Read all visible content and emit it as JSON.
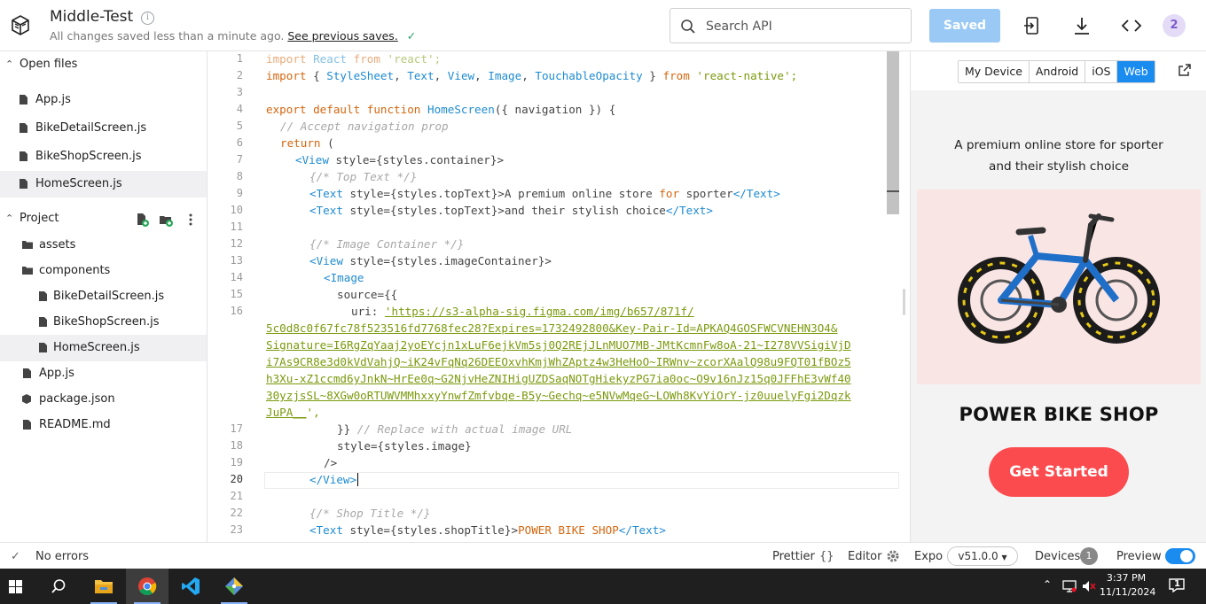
{
  "header": {
    "project_title": "Middle-Test",
    "save_status": "All changes saved less than a minute ago.",
    "previous_saves_link": "See previous saves.",
    "search_placeholder": "Search API",
    "saved_button": "Saved",
    "avatar_count": "2"
  },
  "sidebar": {
    "open_files_label": "Open files",
    "open_files": [
      "App.js",
      "BikeDetailScreen.js",
      "BikeShopScreen.js",
      "HomeScreen.js"
    ],
    "project_label": "Project",
    "tree": {
      "assets": "assets",
      "components": "components",
      "components_children": [
        "BikeDetailScreen.js",
        "BikeShopScreen.js",
        "HomeScreen.js"
      ],
      "app": "App.js",
      "package": "package.json",
      "readme": "README.md"
    }
  },
  "editor": {
    "line_numbers": [
      "1",
      "2",
      "3",
      "4",
      "5",
      "6",
      "7",
      "8",
      "9",
      "10",
      "11",
      "12",
      "13",
      "14",
      "15",
      "16",
      "17",
      "18",
      "19",
      "20",
      "21",
      "22",
      "23"
    ],
    "current_line": "20",
    "code": {
      "l1_import": "import",
      "l1_name": "React",
      "l1_from": "from",
      "l1_str": "'react';",
      "l2_import": "import",
      "l2_names_open": "{ ",
      "l2_names": [
        "StyleSheet",
        "Text",
        "View",
        "Image",
        "TouchableOpacity"
      ],
      "l2_names_close": " }",
      "l2_from": "from",
      "l2_str": "'react-native';",
      "l4_kw": "export default function",
      "l4_fn": "HomeScreen",
      "l4_rest": "({ navigation }) {",
      "l5": "// Accept navigation prop",
      "l6_kw": "return",
      "l6_rest": " (",
      "l7_tag": "<View",
      "l7_rest": " style={styles.container}>",
      "l8": "{/* Top Text */}",
      "l9_open": "<Text",
      "l9_attr": " style={styles.topText}>",
      "l9_text_a": "A premium online store ",
      "l9_for": "for",
      "l9_text_b": " sporter",
      "l9_close": "</Text>",
      "l10_open": "<Text",
      "l10_attr": " style={styles.topText}>",
      "l10_text": "and their stylish choice",
      "l10_close": "</Text>",
      "l12": "{/* Image Container */}",
      "l13_tag": "<View",
      "l13_rest": " style={styles.imageContainer}>",
      "l14_tag": "<Image",
      "l15": "source={{",
      "l16_key": "uri: ",
      "l16_url": "'https://s3-alpha-sig.figma.com/img/b657/871f/",
      "url_wrap": [
        "5c0d8c0f67fc78f523516fd7768fec28?Expires=1732492800&Key-Pair-Id=APKAQ4GOSFWCVNEHN3O4&",
        "Signature=I6RgZqYaaj2yoEYcjn1xLuF6ejkVm5sj0Q2REjJLnMUO7MB-JMtKcmnFw8oA-21~I278VVSigiVjD",
        "i7As9CR8e3d0kVdVahjQ~iK24vFqNq26DEEOxvhKmjWhZAptz4w3HeHoO~IRWnv~zcorXAalQ98u9FQT01fBOz5",
        "h3Xu-xZ1ccmd6yJnkN~HrEe0q~G2NjvHeZNIHigUZDSaqNOTgHiekyzPG7ia0oc~O9v16nJz15q0JFFhE3vWf40",
        "30yzjsSL~8XGw0oRTUWVMMhxxyYnwfZmfvbqe-B5y~Gechq~e5NVwMqeG~LOWh8KvYiOrY-jz0uuelyFgi2Dqzk",
        "JuPA__"
      ],
      "url_tail": "',",
      "l17_rest": "}}",
      "l17_comment": "// Replace with actual image URL",
      "l18": "style={styles.image}",
      "l19": "/>",
      "l20_open": "</",
      "l20_tag": "View",
      "l20_close": ">",
      "l22": "{/* Shop Title */}",
      "l23_open": "<Text",
      "l23_attr": " style={styles.shopTitle}>",
      "l23_text": "POWER BIKE SHOP",
      "l23_close": "</Text>"
    }
  },
  "preview": {
    "tabs": [
      "My Device",
      "Android",
      "iOS",
      "Web"
    ],
    "active_tab": "Web",
    "top_text_1": "A premium online store for sporter",
    "top_text_2": "and their stylish choice",
    "shop_title": "POWER BIKE SHOP",
    "cta_label": "Get Started"
  },
  "statusbar": {
    "errors": "No errors",
    "prettier": "Prettier",
    "prettier_icon": "{}",
    "editor": "Editor",
    "expo": "Expo",
    "expo_version": "v51.0.0",
    "devices": "Devices",
    "devices_count": "1",
    "preview": "Preview"
  },
  "taskbar": {
    "time": "3:37 PM",
    "date": "11/11/2024",
    "notifications": "1"
  },
  "colors": {
    "accent": "#1a8cf0",
    "saved_button": "#99c9f4",
    "cta": "#fb4b4e",
    "keyword": "#d4660f",
    "string": "#7a9a0d",
    "tag": "#1e8bd1"
  }
}
